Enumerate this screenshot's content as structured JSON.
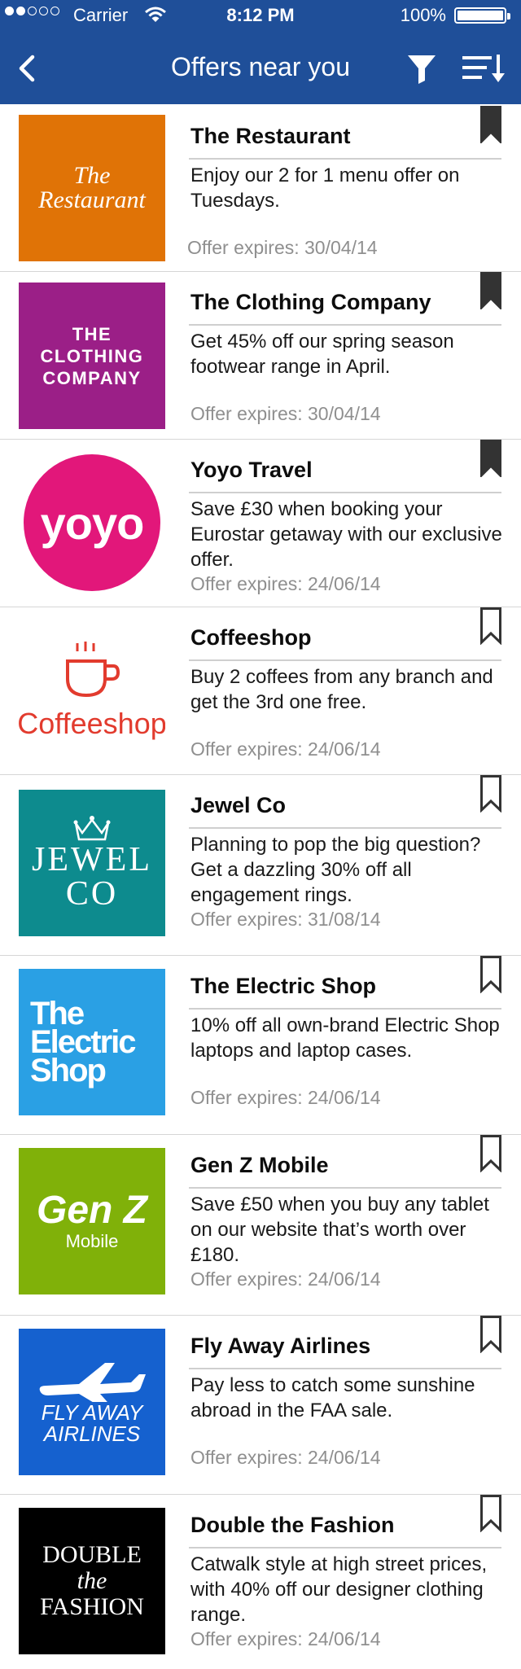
{
  "status_bar": {
    "carrier": "Carrier",
    "time": "8:12 PM",
    "battery": "100%",
    "signal_bars_on": 2,
    "signal_bars_total": 5
  },
  "nav": {
    "title": "Offers near you",
    "back_icon": "chevron-left-icon",
    "filter_icon": "filter-icon",
    "sort_icon": "sort-icon"
  },
  "colors": {
    "nav_background": "#1f4f99",
    "expires_text": "#8f8f8f"
  },
  "offers": [
    {
      "company": "The Restaurant",
      "description": "Enjoy our 2 for 1 menu offer on Tuesdays.",
      "expires": "Offer expires: 30/04/14",
      "bookmarked": true,
      "logo": {
        "line1": "The",
        "line2": "Restaurant"
      }
    },
    {
      "company": "The Clothing Company",
      "description": "Get 45% off our spring season footwear range in April.",
      "expires": "Offer expires: 30/04/14",
      "bookmarked": true,
      "logo": {
        "line1": "THE",
        "line2": "CLOTHING",
        "line3": "COMPANY"
      }
    },
    {
      "company": "Yoyo Travel",
      "description": "Save £30 when booking your Eurostar getaway with our exclusive offer.",
      "expires": "Offer expires: 24/06/14",
      "bookmarked": true,
      "logo": {
        "line1": "yoyo"
      }
    },
    {
      "company": "Coffeeshop",
      "description": "Buy 2 coffees from any branch and get the 3rd one free.",
      "expires": "Offer expires: 24/06/14",
      "bookmarked": false,
      "logo": {
        "line1": "Coffeeshop"
      }
    },
    {
      "company": "Jewel Co",
      "description": "Planning to pop the big question? Get a dazzling 30% off all engagement rings.",
      "expires": "Offer expires: 31/08/14",
      "bookmarked": false,
      "logo": {
        "line1": "JEWEL",
        "line2": "CO"
      }
    },
    {
      "company": "The Electric Shop",
      "description": "10% off all own-brand Electric Shop laptops and laptop cases.",
      "expires": "Offer expires: 24/06/14",
      "bookmarked": false,
      "logo": {
        "line1": "The",
        "line2": "Electric",
        "line3": "Shop"
      }
    },
    {
      "company": "Gen Z Mobile",
      "description": "Save £50 when you buy any tablet on our website that’s worth over £180.",
      "expires": "Offer expires: 24/06/14",
      "bookmarked": false,
      "logo": {
        "line1": "Gen Z",
        "line2": "Mobile"
      }
    },
    {
      "company": "Fly Away Airlines",
      "description": "Pay less to catch some sunshine abroad in the FAA sale.",
      "expires": "Offer expires: 24/06/14",
      "bookmarked": false,
      "logo": {
        "line1": "FLY AWAY",
        "line2": "AIRLINES"
      }
    },
    {
      "company": "Double the Fashion",
      "description": "Catwalk style at high street prices, with 40% off our designer clothing range.",
      "expires": "Offer expires: 24/06/14",
      "bookmarked": false,
      "logo": {
        "line1": "DOUBLE",
        "line2": "the",
        "line3": "FASHION"
      }
    }
  ]
}
